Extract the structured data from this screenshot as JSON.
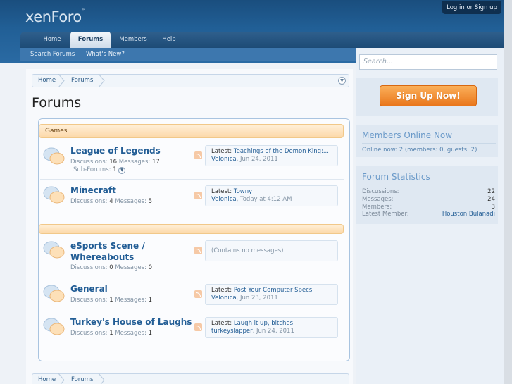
{
  "header": {
    "logo": "xenForo",
    "login_label": "Log in or Sign up"
  },
  "nav": {
    "tabs": [
      {
        "label": "Home"
      },
      {
        "label": "Forums"
      },
      {
        "label": "Members"
      },
      {
        "label": "Help"
      }
    ],
    "sub_links": [
      {
        "label": "Search Forums"
      },
      {
        "label": "What's New?"
      }
    ]
  },
  "breadcrumb": {
    "items": [
      "Home",
      "Forums"
    ]
  },
  "page_title": "Forums",
  "categories": [
    {
      "title": "Games"
    },
    {
      "title": ""
    }
  ],
  "forums": [
    {
      "title": "League of Legends",
      "discussions_label": "Discussions:",
      "discussions": "16",
      "messages_label": "Messages:",
      "messages": "17",
      "subforums_label": "Sub-Forums:",
      "subforums": "1",
      "latest_label": "Latest:",
      "latest_thread": "Teachings of the Demon King:...",
      "latest_user": "Velonica",
      "latest_date": "Jun 24, 2011"
    },
    {
      "title": "Minecraft",
      "discussions_label": "Discussions:",
      "discussions": "4",
      "messages_label": "Messages:",
      "messages": "5",
      "latest_label": "Latest:",
      "latest_thread": "Towny",
      "latest_user": "Velonica",
      "latest_date": "Today at 4:12 AM"
    },
    {
      "title_line1": "eSports Scene /",
      "title_line2": "Whereabouts",
      "discussions_label": "Discussions:",
      "discussions": "0",
      "messages_label": "Messages:",
      "messages": "0",
      "empty_text": "(Contains no messages)"
    },
    {
      "title": "General",
      "discussions_label": "Discussions:",
      "discussions": "1",
      "messages_label": "Messages:",
      "messages": "1",
      "latest_label": "Latest:",
      "latest_thread": "Post Your Computer Specs",
      "latest_user": "Velonica",
      "latest_date": "Jun 23, 2011"
    },
    {
      "title": "Turkey's House of Laughs",
      "discussions_label": "Discussions:",
      "discussions": "1",
      "messages_label": "Messages:",
      "messages": "1",
      "latest_label": "Latest:",
      "latest_thread": "Laugh it up, bitches",
      "latest_user": "turkeyslapper",
      "latest_date": "Jun 24, 2011"
    }
  ],
  "sidebar": {
    "search_placeholder": "Search...",
    "signup_label": "Sign Up Now!",
    "members_online": {
      "heading": "Members Online Now",
      "text": "Online now: 2 (members: 0, guests: 2)"
    },
    "forum_stats": {
      "heading": "Forum Statistics",
      "rows": [
        {
          "label": "Discussions:",
          "value": "22"
        },
        {
          "label": "Messages:",
          "value": "24"
        },
        {
          "label": "Members:",
          "value": "3"
        },
        {
          "label": "Latest Member:",
          "value": "Houston Bulanadi"
        }
      ]
    }
  },
  "colors": {
    "header_blue": "#215f96",
    "link_blue": "#225d95",
    "category_orange": "#fcd8a8",
    "signup_orange": "#e9761b"
  }
}
